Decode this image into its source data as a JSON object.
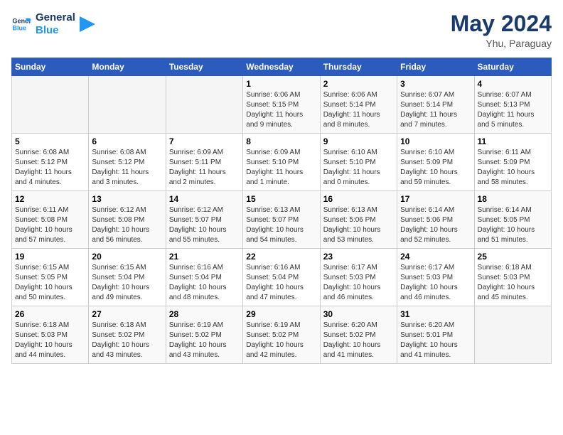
{
  "header": {
    "logo_line1": "General",
    "logo_line2": "Blue",
    "month": "May 2024",
    "location": "Yhu, Paraguay"
  },
  "weekdays": [
    "Sunday",
    "Monday",
    "Tuesday",
    "Wednesday",
    "Thursday",
    "Friday",
    "Saturday"
  ],
  "weeks": [
    [
      {
        "day": "",
        "info": ""
      },
      {
        "day": "",
        "info": ""
      },
      {
        "day": "",
        "info": ""
      },
      {
        "day": "1",
        "info": "Sunrise: 6:06 AM\nSunset: 5:15 PM\nDaylight: 11 hours\nand 9 minutes."
      },
      {
        "day": "2",
        "info": "Sunrise: 6:06 AM\nSunset: 5:14 PM\nDaylight: 11 hours\nand 8 minutes."
      },
      {
        "day": "3",
        "info": "Sunrise: 6:07 AM\nSunset: 5:14 PM\nDaylight: 11 hours\nand 7 minutes."
      },
      {
        "day": "4",
        "info": "Sunrise: 6:07 AM\nSunset: 5:13 PM\nDaylight: 11 hours\nand 5 minutes."
      }
    ],
    [
      {
        "day": "5",
        "info": "Sunrise: 6:08 AM\nSunset: 5:12 PM\nDaylight: 11 hours\nand 4 minutes."
      },
      {
        "day": "6",
        "info": "Sunrise: 6:08 AM\nSunset: 5:12 PM\nDaylight: 11 hours\nand 3 minutes."
      },
      {
        "day": "7",
        "info": "Sunrise: 6:09 AM\nSunset: 5:11 PM\nDaylight: 11 hours\nand 2 minutes."
      },
      {
        "day": "8",
        "info": "Sunrise: 6:09 AM\nSunset: 5:10 PM\nDaylight: 11 hours\nand 1 minute."
      },
      {
        "day": "9",
        "info": "Sunrise: 6:10 AM\nSunset: 5:10 PM\nDaylight: 11 hours\nand 0 minutes."
      },
      {
        "day": "10",
        "info": "Sunrise: 6:10 AM\nSunset: 5:09 PM\nDaylight: 10 hours\nand 59 minutes."
      },
      {
        "day": "11",
        "info": "Sunrise: 6:11 AM\nSunset: 5:09 PM\nDaylight: 10 hours\nand 58 minutes."
      }
    ],
    [
      {
        "day": "12",
        "info": "Sunrise: 6:11 AM\nSunset: 5:08 PM\nDaylight: 10 hours\nand 57 minutes."
      },
      {
        "day": "13",
        "info": "Sunrise: 6:12 AM\nSunset: 5:08 PM\nDaylight: 10 hours\nand 56 minutes."
      },
      {
        "day": "14",
        "info": "Sunrise: 6:12 AM\nSunset: 5:07 PM\nDaylight: 10 hours\nand 55 minutes."
      },
      {
        "day": "15",
        "info": "Sunrise: 6:13 AM\nSunset: 5:07 PM\nDaylight: 10 hours\nand 54 minutes."
      },
      {
        "day": "16",
        "info": "Sunrise: 6:13 AM\nSunset: 5:06 PM\nDaylight: 10 hours\nand 53 minutes."
      },
      {
        "day": "17",
        "info": "Sunrise: 6:14 AM\nSunset: 5:06 PM\nDaylight: 10 hours\nand 52 minutes."
      },
      {
        "day": "18",
        "info": "Sunrise: 6:14 AM\nSunset: 5:05 PM\nDaylight: 10 hours\nand 51 minutes."
      }
    ],
    [
      {
        "day": "19",
        "info": "Sunrise: 6:15 AM\nSunset: 5:05 PM\nDaylight: 10 hours\nand 50 minutes."
      },
      {
        "day": "20",
        "info": "Sunrise: 6:15 AM\nSunset: 5:04 PM\nDaylight: 10 hours\nand 49 minutes."
      },
      {
        "day": "21",
        "info": "Sunrise: 6:16 AM\nSunset: 5:04 PM\nDaylight: 10 hours\nand 48 minutes."
      },
      {
        "day": "22",
        "info": "Sunrise: 6:16 AM\nSunset: 5:04 PM\nDaylight: 10 hours\nand 47 minutes."
      },
      {
        "day": "23",
        "info": "Sunrise: 6:17 AM\nSunset: 5:03 PM\nDaylight: 10 hours\nand 46 minutes."
      },
      {
        "day": "24",
        "info": "Sunrise: 6:17 AM\nSunset: 5:03 PM\nDaylight: 10 hours\nand 46 minutes."
      },
      {
        "day": "25",
        "info": "Sunrise: 6:18 AM\nSunset: 5:03 PM\nDaylight: 10 hours\nand 45 minutes."
      }
    ],
    [
      {
        "day": "26",
        "info": "Sunrise: 6:18 AM\nSunset: 5:03 PM\nDaylight: 10 hours\nand 44 minutes."
      },
      {
        "day": "27",
        "info": "Sunrise: 6:18 AM\nSunset: 5:02 PM\nDaylight: 10 hours\nand 43 minutes."
      },
      {
        "day": "28",
        "info": "Sunrise: 6:19 AM\nSunset: 5:02 PM\nDaylight: 10 hours\nand 43 minutes."
      },
      {
        "day": "29",
        "info": "Sunrise: 6:19 AM\nSunset: 5:02 PM\nDaylight: 10 hours\nand 42 minutes."
      },
      {
        "day": "30",
        "info": "Sunrise: 6:20 AM\nSunset: 5:02 PM\nDaylight: 10 hours\nand 41 minutes."
      },
      {
        "day": "31",
        "info": "Sunrise: 6:20 AM\nSunset: 5:01 PM\nDaylight: 10 hours\nand 41 minutes."
      },
      {
        "day": "",
        "info": ""
      }
    ]
  ]
}
